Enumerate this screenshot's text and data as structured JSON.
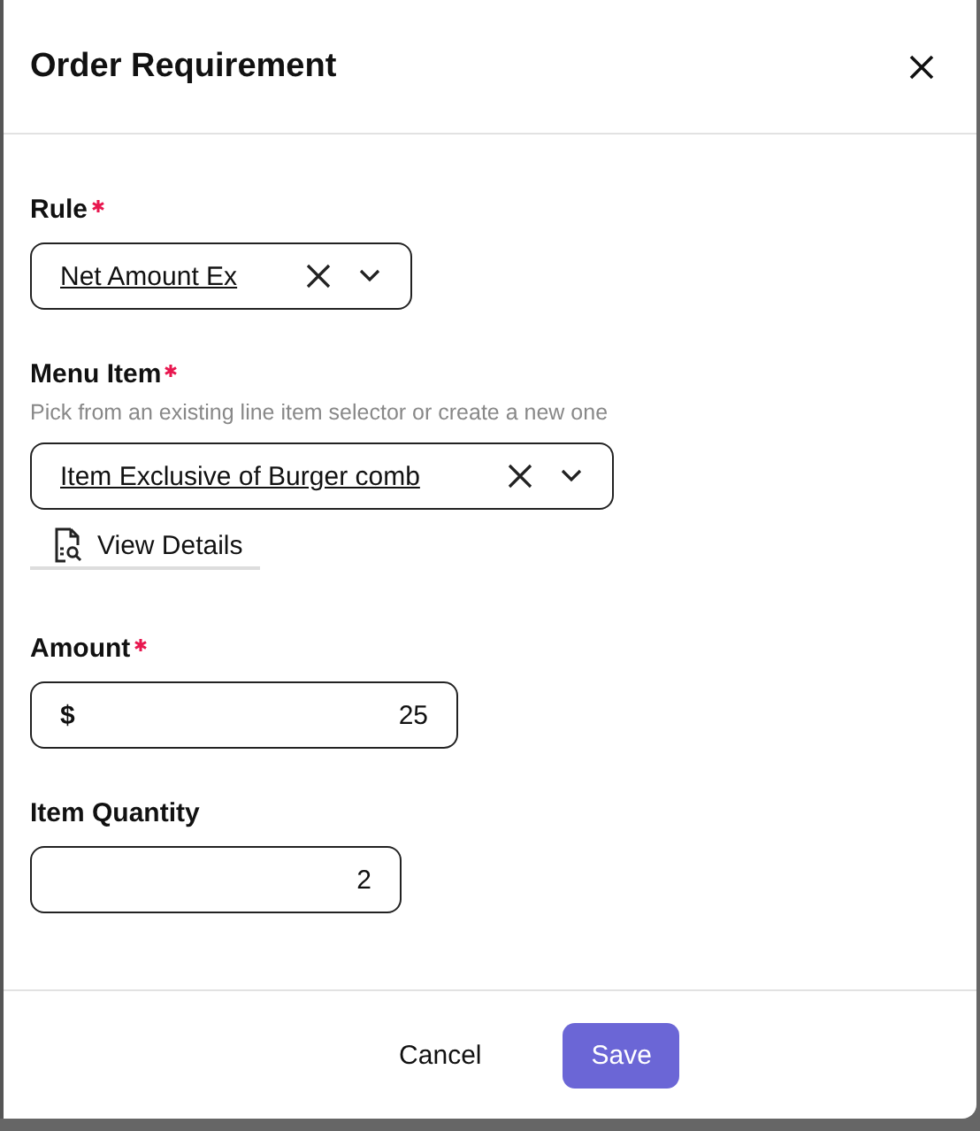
{
  "dialog": {
    "title": "Order Requirement"
  },
  "fields": [
    {
      "kind": "select",
      "label": "Rule",
      "required": true,
      "value": "Net Amount Ex"
    },
    {
      "kind": "select",
      "label": "Menu Item",
      "required": true,
      "hint": "Pick from an existing line item selector or create a new one",
      "value": "Item Exclusive of Burger comb",
      "link": "View Details"
    },
    {
      "kind": "number",
      "label": "Amount",
      "required": true,
      "prefix": "$",
      "value": "25"
    },
    {
      "kind": "number",
      "label": "Item Quantity",
      "required": false,
      "value": "2"
    }
  ],
  "buttons": [
    {
      "label": "Cancel",
      "kind": "secondary"
    },
    {
      "label": "Save",
      "kind": "primary"
    }
  ]
}
